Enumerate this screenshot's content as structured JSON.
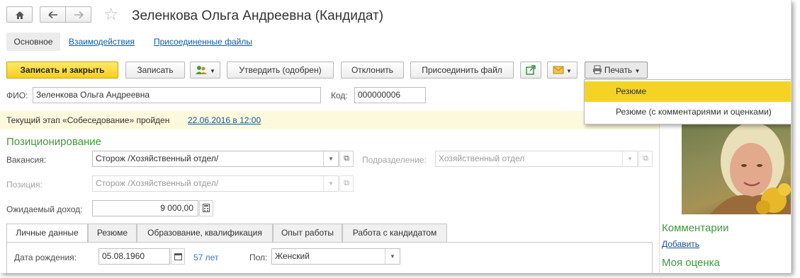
{
  "window": {
    "title": "Зеленкова Ольга Андреевна (Кандидат)",
    "nav_links": [
      "Основное",
      "Взаимодействия",
      "Присоединенные файлы"
    ]
  },
  "toolbar": {
    "save_close": "Записать и закрыть",
    "save": "Записать",
    "approve": "Утвердить (одобрен)",
    "reject": "Отклонить",
    "attach": "Присоединить файл",
    "print": "Печать"
  },
  "print_menu": {
    "items": [
      "Резюме",
      "Резюме (с комментариями и оценками)"
    ],
    "selected_index": 0
  },
  "form": {
    "fio_label": "ФИО:",
    "fio_value": "Зеленкова Ольга Андреевна",
    "code_label": "Код:",
    "code_value": "000000006",
    "stage_text": "Текущий этап «Собеседование» пройден",
    "stage_date": "22.06.2016 в 12:00",
    "section_title": "Позиционирование",
    "vacancy_label": "Вакансия:",
    "vacancy_value": "Сторож /Хозяйственный отдел/",
    "division_label": "Подразделение:",
    "division_value": "Хозяйственный отдел",
    "position_label": "Позиция:",
    "position_value": "Сторож /Хозяйственный отдел/",
    "income_label": "Ожидаемый доход:",
    "income_value": "9 000,00"
  },
  "tabs": [
    "Личные данные",
    "Резюме",
    "Образование, квалификация",
    "Опыт работы",
    "Работа с кандидатом"
  ],
  "personal": {
    "birth_label": "Дата рождения:",
    "birth_value": "05.08.1960",
    "age": "57 лет",
    "sex_label": "Пол:",
    "sex_value": "Женский"
  },
  "right_panel": {
    "comments_title": "Комментарии",
    "add_link": "Добавить",
    "rating_title": "Моя оценка"
  },
  "colors": {
    "accent_yellow": "#f5cf1f",
    "green_heading": "#3b9b3b",
    "link_blue": "#0b5ea8",
    "highlight_bg": "#fdf9dc"
  }
}
